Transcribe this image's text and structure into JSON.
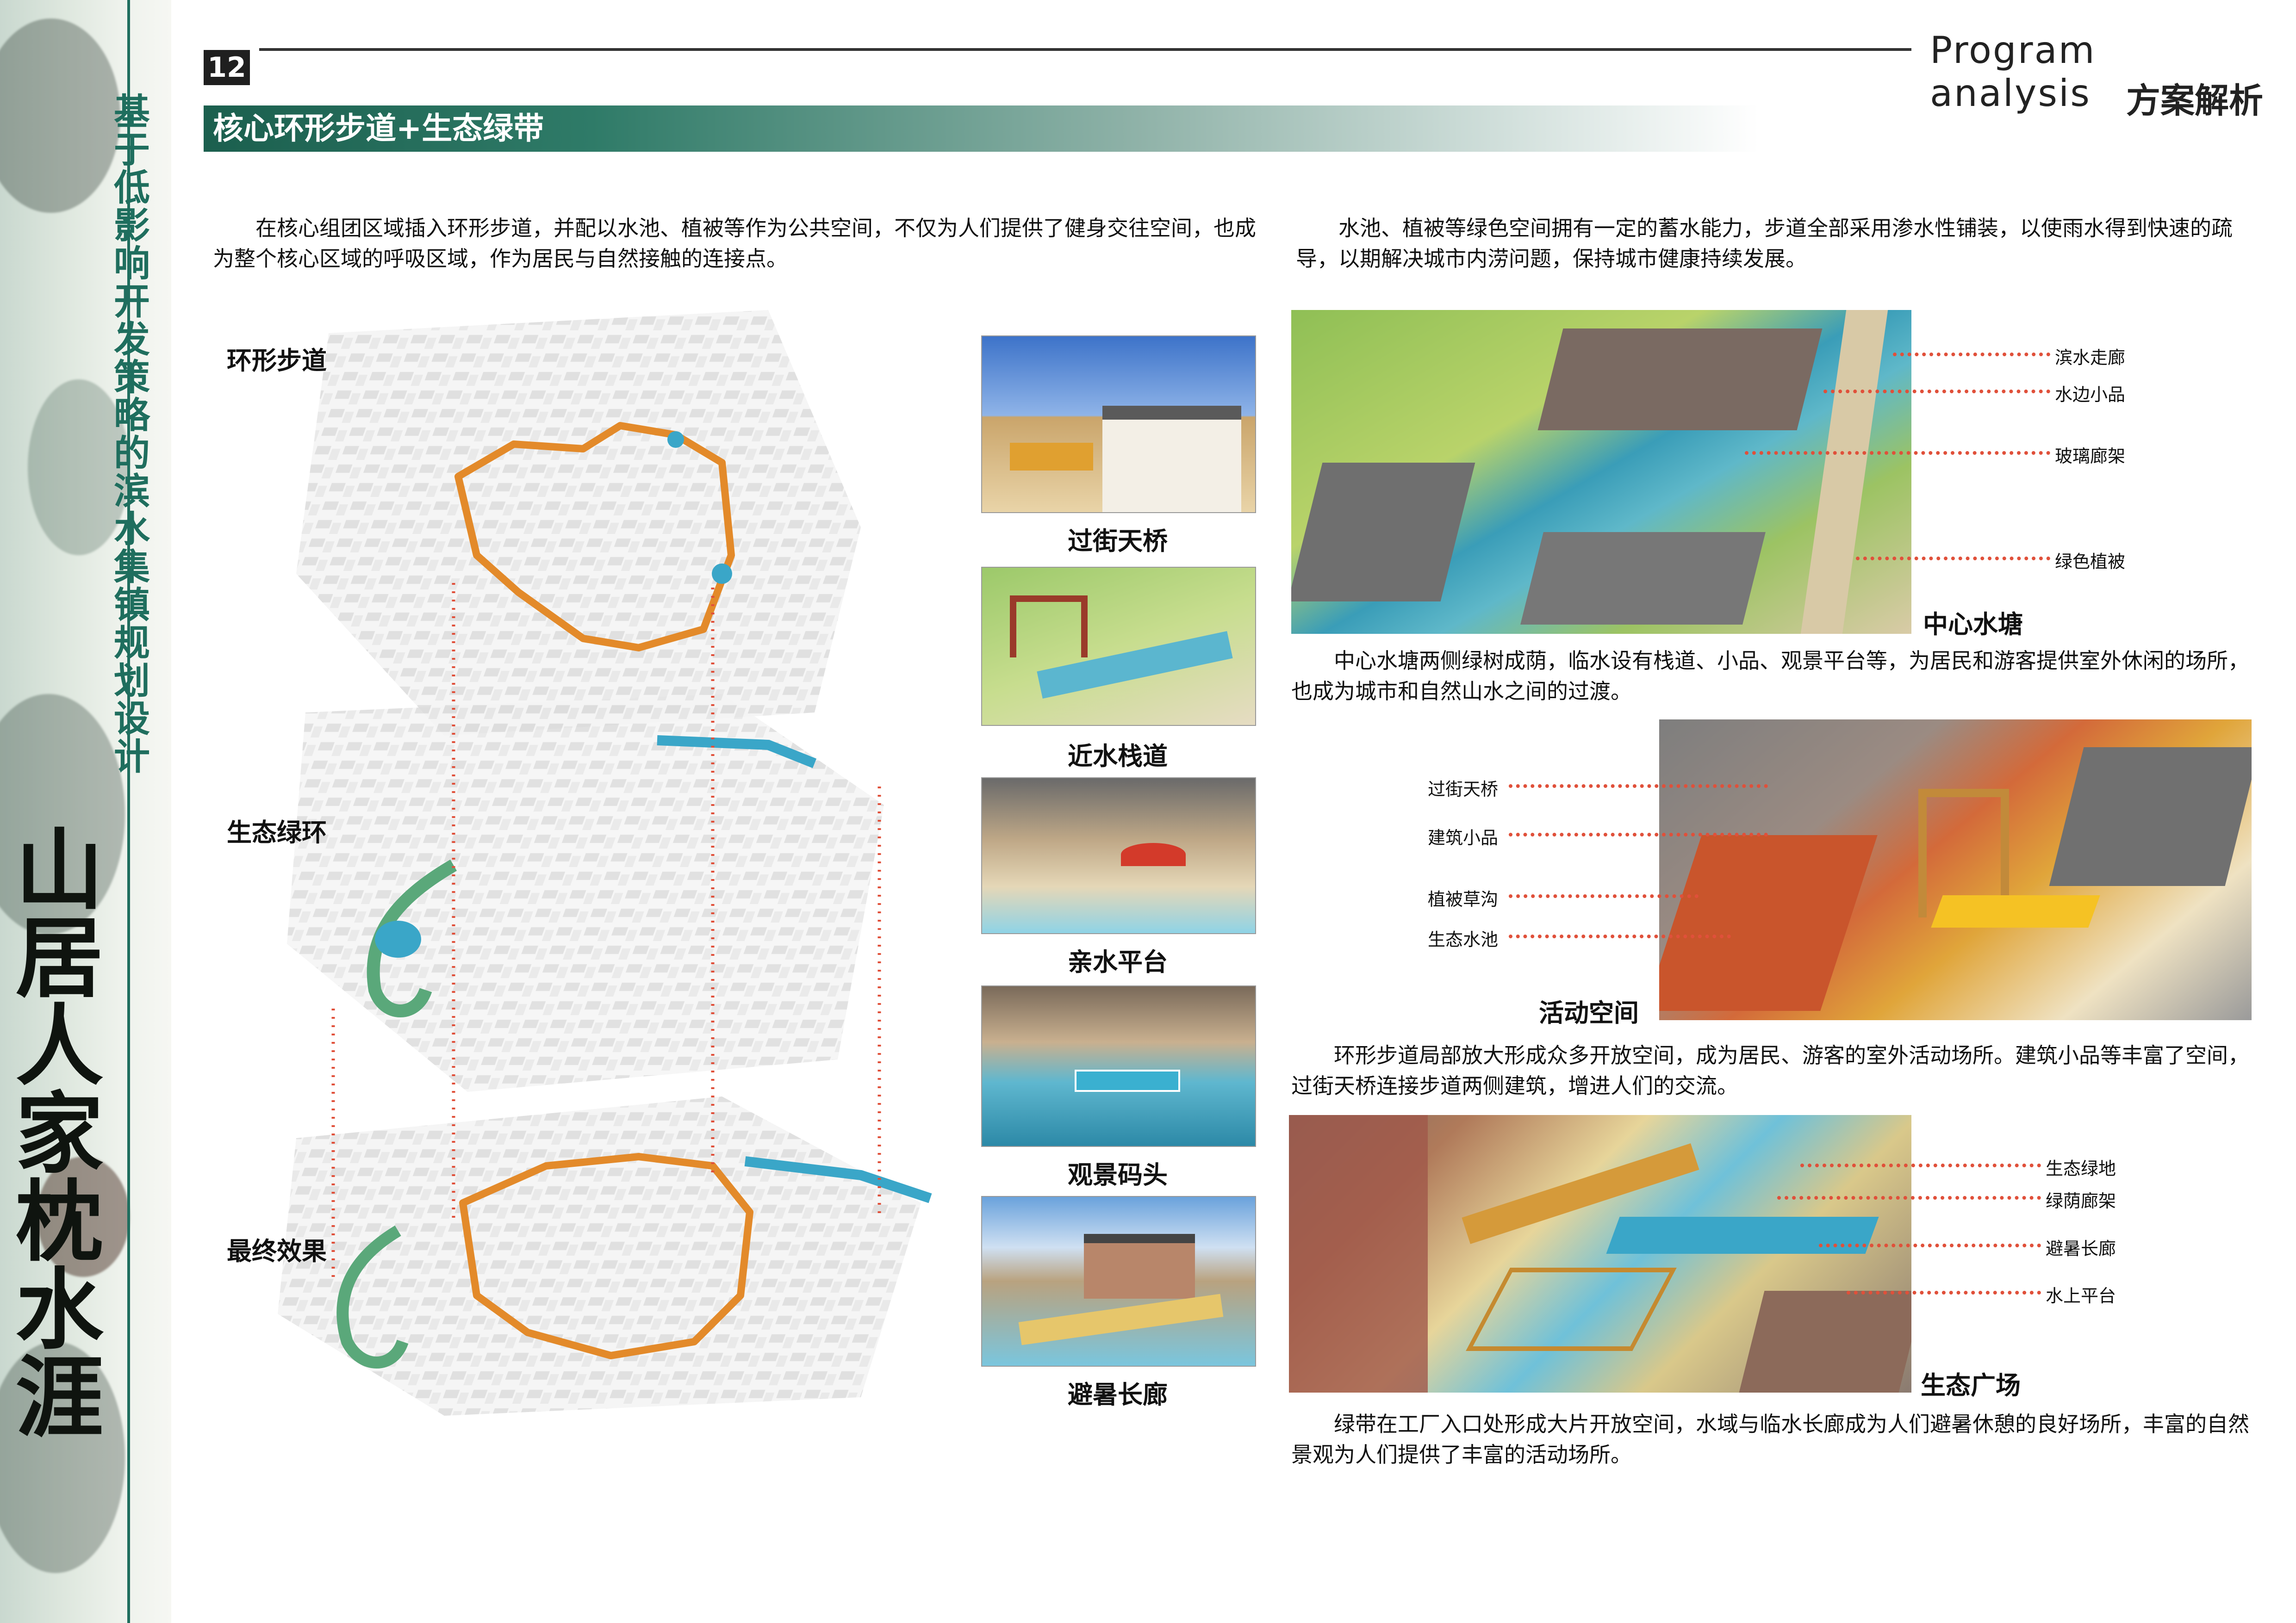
{
  "sidebar": {
    "subtitle": "基于低影响开发策略的滨水集镇规划设计",
    "title": "山居人家枕水涯"
  },
  "header": {
    "page_number": "12",
    "en_title": "Program analysis",
    "cn_title": "方案解析"
  },
  "section": {
    "title": "核心环形步道+生态绿带"
  },
  "intro_left": "在核心组团区域插入环形步道，并配以水池、植被等作为公共空间，不仅为人们提供了健身交往空间，也成为整个核心区域的呼吸区域，作为居民与自然接触的连接点。",
  "intro_right": "水池、植被等绿色空间拥有一定的蓄水能力，步道全部采用渗水性铺装，以使雨水得到快速的疏导，以期解决城市内涝问题，保持城市健康持续发展。",
  "map": {
    "labels": [
      "环形步道",
      "生态绿环",
      "最终效果"
    ]
  },
  "photos": {
    "captions": [
      "过街天桥",
      "近水栈道",
      "亲水平台",
      "观景码头",
      "避暑长廊"
    ]
  },
  "renders": [
    {
      "caption": "中心水塘",
      "labels": [
        "滨水走廊",
        "水边小品",
        "玻璃廊架",
        "绿色植被"
      ],
      "text": "中心水塘两侧绿树成荫，临水设有栈道、小品、观景平台等，为居民和游客提供室外休闲的场所，也成为城市和自然山水之间的过渡。"
    },
    {
      "caption": "活动空间",
      "labels": [
        "过街天桥",
        "建筑小品",
        "植被草沟",
        "生态水池"
      ],
      "text": "环形步道局部放大形成众多开放空间，成为居民、游客的室外活动场所。建筑小品等丰富了空间，过街天桥连接步道两侧建筑，增进人们的交流。"
    },
    {
      "caption": "生态广场",
      "labels": [
        "生态绿地",
        "绿荫廊架",
        "避暑长廊",
        "水上平台"
      ],
      "text": "绿带在工厂入口处形成大片开放空间，水域与临水长廊成为人们避暑休憩的良好场所，丰富的自然景观为人们提供了丰富的活动场所。"
    }
  ],
  "colors": {
    "accent_green": "#1f6e5e",
    "path_orange": "#e38a2a",
    "dotted_red": "#e0503a",
    "water_blue": "#3aa6c8"
  }
}
